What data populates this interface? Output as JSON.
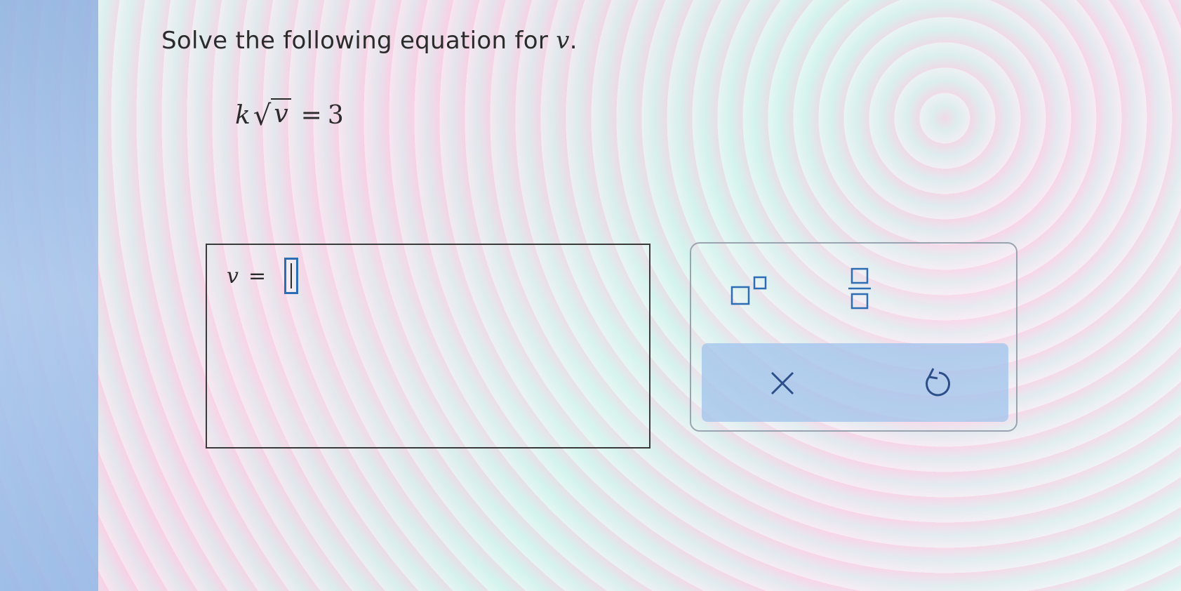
{
  "question": {
    "prompt_text": "Solve the following equation for",
    "variable": "v",
    "period": "."
  },
  "equation": {
    "coefficient": "k",
    "radicand": "v",
    "equals": "=",
    "rhs": "3"
  },
  "answer": {
    "lhs": "v",
    "equals": "=",
    "value": ""
  },
  "toolbox": {
    "buttons": [
      {
        "name": "superscript",
        "icon": "superscript-icon"
      },
      {
        "name": "fraction",
        "icon": "fraction-icon"
      },
      {
        "name": "clear",
        "icon": "close-icon"
      },
      {
        "name": "undo",
        "icon": "undo-icon"
      }
    ]
  },
  "colors": {
    "accent": "#2c6db3",
    "bottom_bar": "#a9c6ec"
  }
}
